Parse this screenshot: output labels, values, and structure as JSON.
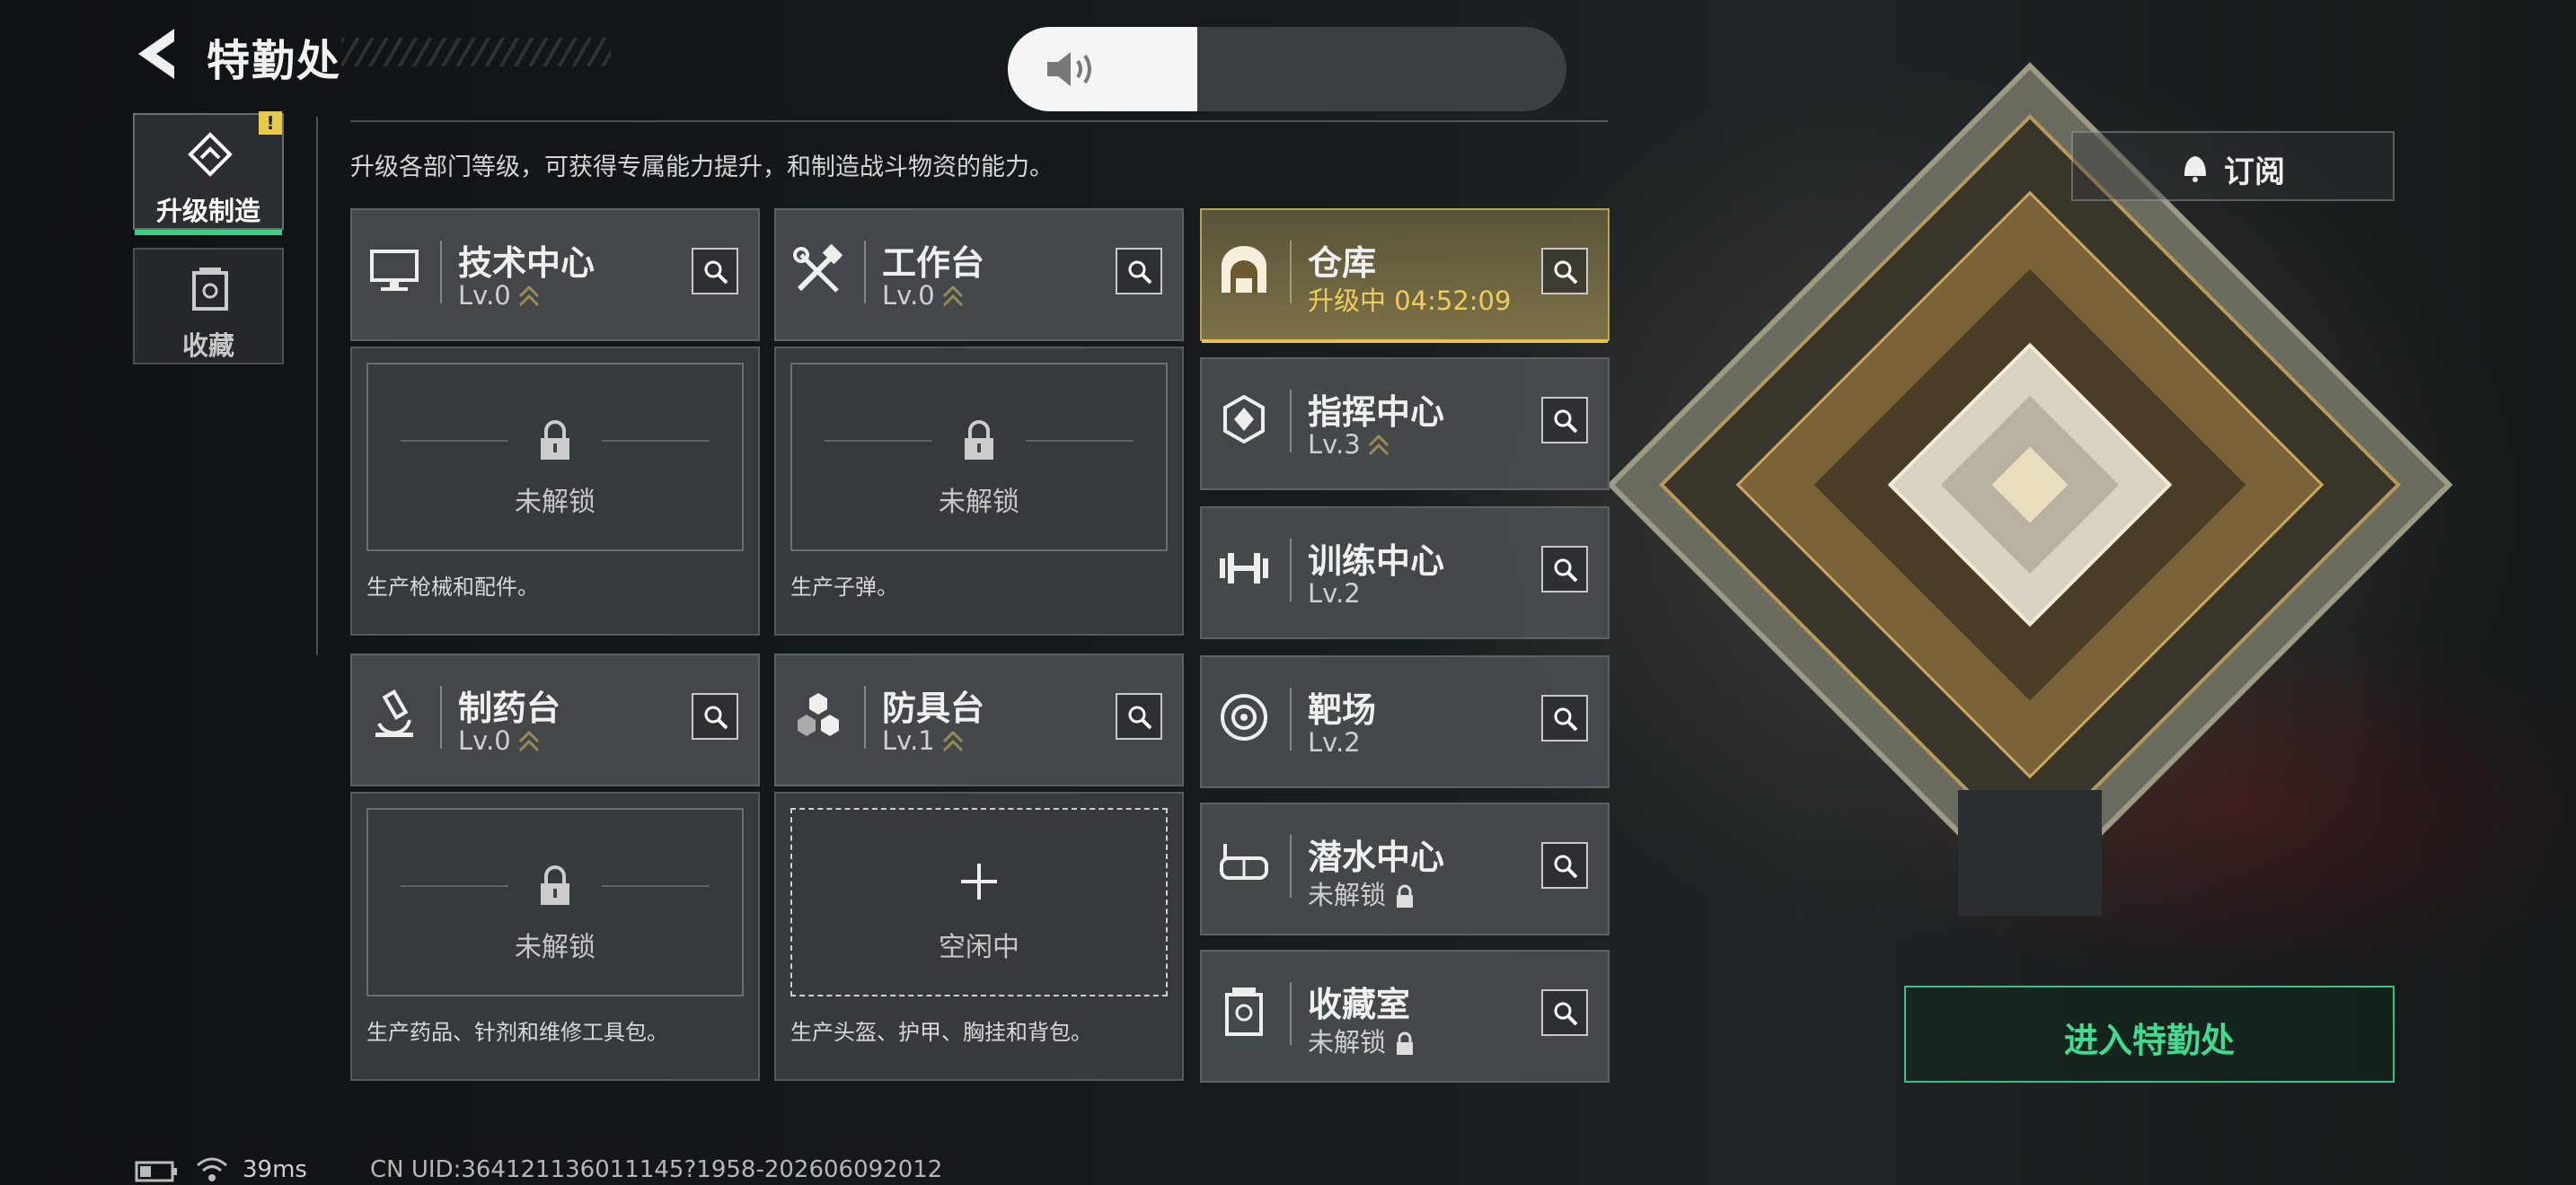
{
  "header": {
    "title": "特勤处"
  },
  "sidebar": {
    "items": [
      {
        "label": "升级制造",
        "active": true,
        "icon": "upgrade-icon",
        "alert": "!"
      },
      {
        "label": "收藏",
        "active": false,
        "icon": "collection-icon"
      }
    ]
  },
  "description": "升级各部门等级，可获得专属能力提升，和制造战斗物资的能力。",
  "grid": {
    "tech_center": {
      "name": "技术中心",
      "level": "Lv.0",
      "icon": "monitor-icon"
    },
    "workbench": {
      "name": "工作台",
      "level": "Lv.0",
      "icon": "tools-icon"
    },
    "pharmacy": {
      "name": "制药台",
      "level": "Lv.0",
      "icon": "microscope-icon"
    },
    "armor_bench": {
      "name": "防具台",
      "level": "Lv.1",
      "icon": "hexagons-icon"
    },
    "panel_tech": {
      "state": "未解锁",
      "desc": "生产枪械和配件。"
    },
    "panel_workbench": {
      "state": "未解锁",
      "desc": "生产子弹。"
    },
    "panel_pharmacy": {
      "state": "未解锁",
      "desc": "生产药品、针剂和维修工具包。"
    },
    "panel_armor": {
      "state": "空闲中",
      "desc": "生产头盔、护甲、胸挂和背包。"
    }
  },
  "right_column": [
    {
      "name": "仓库",
      "status": "升级中 04:52:09",
      "icon": "warehouse-icon",
      "highlight": true
    },
    {
      "name": "指挥中心",
      "status": "Lv.3",
      "icon": "command-chip-icon"
    },
    {
      "name": "训练中心",
      "status": "Lv.2",
      "icon": "dumbbell-icon"
    },
    {
      "name": "靶场",
      "status": "Lv.2",
      "icon": "target-icon"
    },
    {
      "name": "潜水中心",
      "status": "未解锁",
      "icon": "diving-mask-icon",
      "locked": true
    },
    {
      "name": "收藏室",
      "status": "未解锁",
      "icon": "trophy-case-icon",
      "locked": true
    }
  ],
  "actions": {
    "subscribe": "订阅",
    "enter": "进入特勤处"
  },
  "volume": {
    "level_fraction": 0.34
  },
  "footer": {
    "ping": "39ms",
    "uid": "CN UID:364121136011145?1958-202606092012"
  },
  "colors": {
    "accent_green": "#3ccf84",
    "gold": "#e7c24e",
    "alert_yellow": "#e9c94a"
  }
}
